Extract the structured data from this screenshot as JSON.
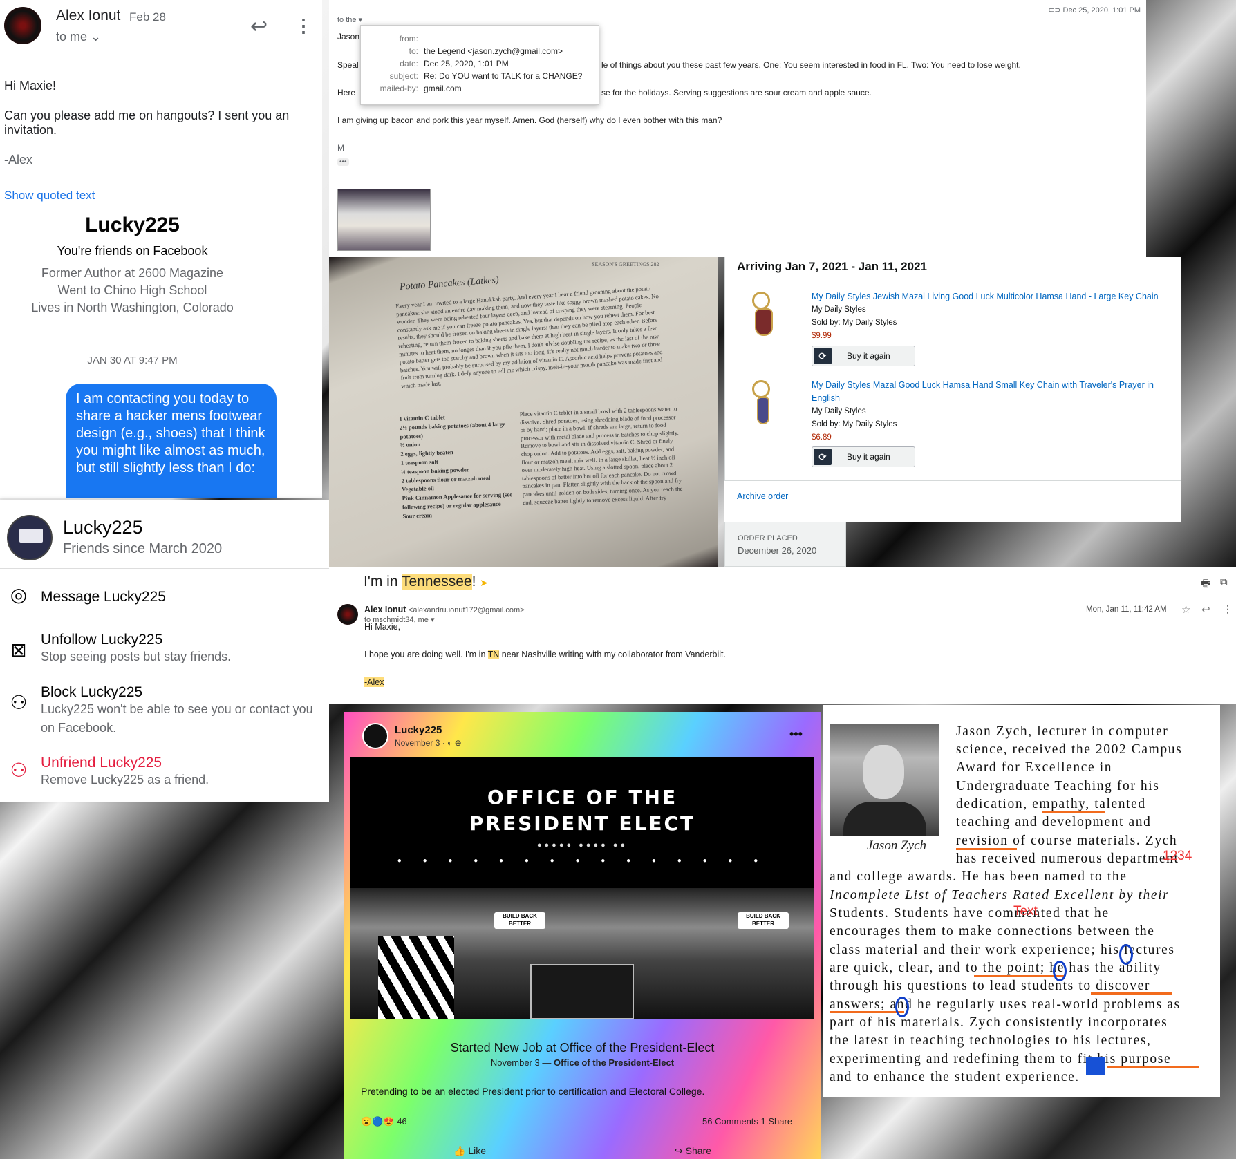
{
  "gmail_mobile": {
    "sender": "Alex Ionut",
    "date": "Feb 28",
    "to": "to me",
    "greeting": "Hi Maxie!",
    "body": "Can you please add me on hangouts? I sent you an invitation.",
    "signature": "-Alex",
    "show_quoted": "Show quoted text",
    "fb_profile_name": "Lucky225",
    "fb_friends": "You're friends on Facebook",
    "fb_info": [
      "Former Author at 2600 Magazine",
      "Went to Chino High School",
      "Lives in North Washington, Colorado"
    ],
    "timestamp": "JAN 30 AT 9:47 PM",
    "message": "I am contacting you today to share a hacker mens footwear design (e.g., shoes) that I think you might like almost as much, but still slightly less than I do:"
  },
  "fb_menu": {
    "name": "Lucky225",
    "since": "Friends since March 2020",
    "message": "Message Lucky225",
    "unfollow": "Unfollow Lucky225",
    "unfollow_sub": "Stop seeing posts but stay friends.",
    "block": "Block Lucky225",
    "block_sub": "Lucky225 won't be able to see you or contact you on Facebook.",
    "unfriend": "Unfriend Lucky225",
    "unfriend_sub": "Remove Lucky225 as a friend."
  },
  "gmail_desktop": {
    "to_line": "to the",
    "name_partial": "Jason",
    "date": "Dec 25, 2020, 1:01 PM",
    "line1_start": "Speal",
    "line1_end": "le of things about you these past few years. One: You seem interested in food in FL. Two: You need to lose weight.",
    "line2_start": "Here",
    "line2_end": "se for the holidays. Serving suggestions are sour cream and apple sauce.",
    "line3": "I am giving up bacon and pork this year myself. Amen. God (herself) why do I even bother with this man?",
    "initial": "M",
    "popup": {
      "from_label": "from:",
      "to_label": "to:",
      "to_value": "the Legend <jason.zych@gmail.com>",
      "date_label": "date:",
      "date_value": "Dec 25, 2020, 1:01 PM",
      "subject_label": "subject:",
      "subject_value": "Re: Do YOU want to TALK for a CHANGE?",
      "mailedby_label": "mailed-by:",
      "mailedby_value": "gmail.com"
    }
  },
  "cookbook": {
    "header": "SEASON'S GREETINGS  282",
    "title": "Potato Pancakes (Latkes)",
    "paragraph": "Every year I am invited to a large Hanukkah party. And every year I hear a friend groaning about the potato pancakes: she stood an entire day making them, and now they taste like soggy brown mashed potato cakes. No wonder. They were being reheated four layers deep, and instead of crisping they were steaming. People constantly ask me if you can freeze potato pancakes. Yes, but that depends on how you reheat them. For best results, they should be frozen on baking sheets in single layers; then they can be piled atop each other. Before reheating, return them frozen to baking sheets and bake them at high heat in single layers. It only takes a few minutes to heat them, no longer than if you pile them. I don't advise doubling the recipe, as the last of the raw potato batter gets too starchy and brown when it sits too long. It's really not much harder to make two or three batches. You will probably be surprised by my addition of vitamin C. Ascorbic acid helps prevent potatoes and fruit from turning dark. I defy anyone to tell me which crispy, melt-in-your-mouth pancake was made first and which made last.",
    "ingredients": "1 vitamin C tablet\n2½ pounds baking potatoes (about 4 large potatoes)\n½ onion\n2 eggs, lightly beaten\n1 teaspoon salt\n¼ teaspoon baking powder\n2 tablespoons flour or matzoh meal\nVegetable oil\nPink Cinnamon Applesauce for serving (see following recipe) or regular applesauce\nSour cream",
    "method": "Place vitamin C tablet in a small bowl with 2 tablespoons water to dissolve. Shred potatoes, using shredding blade of food processor or by hand; place in a bowl. If shreds are large, return to food processor with metal blade and process in batches to chop slightly. Remove to bowl and stir in dissolved vitamin C. Shred or finely chop onion. Add to potatoes. Add eggs, salt, baking powder, and flour or matzoh meal; mix well. In a large skillet, heat ½ inch oil over moderately high heat. Using a slotted spoon, place about 2 tablespoons of batter into hot oil for each pancake. Do not crowd pancakes in pan. Flatten slightly with the back of the spoon and fry pancakes until golden on both sides, turning once. As you reach the end, squeeze batter lightly to remove excess liquid. After fry-"
  },
  "amazon": {
    "arriving": "Arriving Jan 7, 2021 - Jan 11, 2021",
    "items": [
      {
        "title": "My Daily Styles Jewish Mazal Living Good Luck Multicolor Hamsa Hand - Large Key Chain",
        "brand": "My Daily Styles",
        "seller": "Sold by: My Daily Styles",
        "price": "$9.99",
        "button": "Buy it again"
      },
      {
        "title": "My Daily Styles Mazal Good Luck Hamsa Hand Small Key Chain with Traveler's Prayer in English",
        "brand": "My Daily Styles",
        "seller": "Sold by: My Daily Styles",
        "price": "$6.89",
        "button": "Buy it again"
      }
    ],
    "archive": "Archive order",
    "order_placed_label": "ORDER PLACED",
    "order_placed_date": "December 26, 2020"
  },
  "gmail_tn": {
    "subject_pre": "I'm in ",
    "subject_hl": "Tennessee",
    "subject_post": "!",
    "sender_name": "Alex Ionut",
    "sender_email": "<alexandru.ionut172@gmail.com>",
    "to": "to mschmidt34, me",
    "date": "Mon, Jan 11, 11:42 AM",
    "greeting": "Hi Maxie,",
    "body_pre": "I hope you are doing well. I'm in ",
    "body_hl": "TN",
    "body_post": " near Nashville writing with my collaborator from Vanderbilt.",
    "signature": "-Alex"
  },
  "fb_post": {
    "name": "Lucky225",
    "date": "November 3 · ",
    "office_line1": "OFFICE OF THE",
    "office_line2": "PRESIDENT ELECT",
    "banner": "BUILD BACK BETTER",
    "job_title": "Started New Job at Office of the President-Elect",
    "job_date": "November 3 — ",
    "job_org": "Office of the President-Elect",
    "caption": "Pretending to be an elected President prior to certification and Electoral College.",
    "reaction_count": "46",
    "stats": "56 Comments  1 Share",
    "like": "Like",
    "share": "Share"
  },
  "bio": {
    "caption": "Jason Zych",
    "lines": [
      "Jason Zych, lecturer in computer",
      "science, received the 2002 Campus",
      "Award for Excellence in",
      "Undergraduate Teaching for his",
      "dedication, empathy, talented",
      "teaching and development and",
      "revision of course materials. Zych",
      "has received numerous department",
      "and college awards. He has been named to the",
      "Incomplete List of Teachers Rated Excellent by their",
      "Students. Students have commented that he",
      "encourages them to make connections between the",
      "class material and their work experience; his lectures",
      "are quick, clear, and to the point; he has the ability",
      "through his questions to lead students to discover",
      "answers; and he regularly uses real-world problems as",
      "part of his materials. Zych consistently incorporates",
      "the latest in teaching technologies to his lectures,",
      "experimenting and redefining them to fit his purpose",
      "and to enhance the student experience."
    ],
    "annotation_num": "1234",
    "annotation_text": "Text"
  }
}
